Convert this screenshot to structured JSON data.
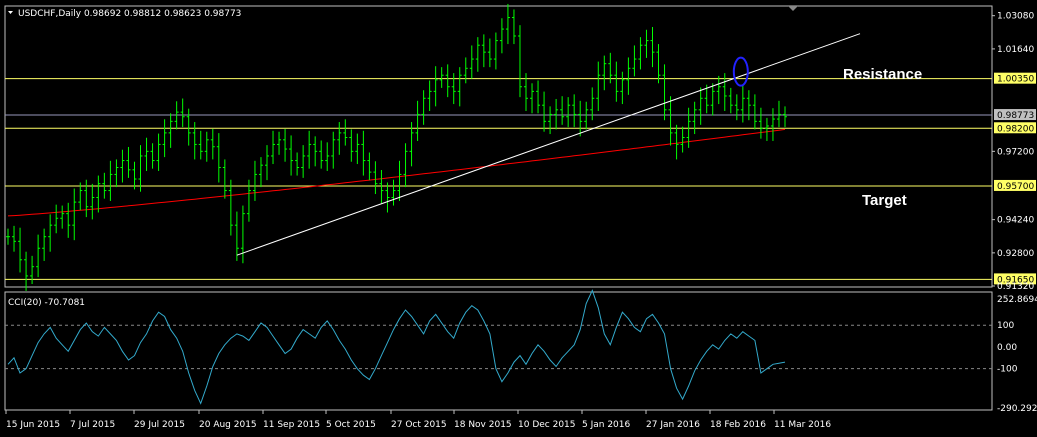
{
  "header": {
    "symbol_line": "USDCHF,Daily  0.98692 0.98812 0.98623 0.98773"
  },
  "annotations": {
    "resistance": "Resistance",
    "target": "Target"
  },
  "colors": {
    "background": "#000000",
    "candles": "#00ff00",
    "moving_average": "#ff0000",
    "trendline": "#ffffff",
    "levels": "#ffff66",
    "current_price": "#9999bb",
    "cci": "#33aacc",
    "ellipse": "#2222ff"
  },
  "chart_data": [
    {
      "type": "candlestick",
      "title": "USDCHF,Daily",
      "ylim": [
        0.9132,
        1.035
      ],
      "x_tick_labels": [
        "15 Jun 2015",
        "7 Jul 2015",
        "29 Jul 2015",
        "20 Aug 2015",
        "11 Sep 2015",
        "5 Oct 2015",
        "27 Oct 2015",
        "18 Nov 2015",
        "10 Dec 2015",
        "5 Jan 2016",
        "27 Jan 2016",
        "18 Feb 2016",
        "11 Mar 2016"
      ],
      "y_tick_labels": [
        "1.03080",
        "1.01640",
        "1.00350",
        "0.98773",
        "0.98200",
        "0.97200",
        "0.95700",
        "0.94240",
        "0.92800",
        "0.91650",
        "0.91320"
      ],
      "horizontal_levels": [
        1.0035,
        0.982,
        0.957,
        0.9165
      ],
      "current_price": 0.98773,
      "close_series": [
        0.935,
        0.933,
        0.925,
        0.918,
        0.922,
        0.93,
        0.935,
        0.94,
        0.943,
        0.945,
        0.94,
        0.95,
        0.955,
        0.948,
        0.952,
        0.958,
        0.955,
        0.962,
        0.965,
        0.968,
        0.964,
        0.96,
        0.97,
        0.972,
        0.968,
        0.975,
        0.98,
        0.985,
        0.989,
        0.987,
        0.98,
        0.975,
        0.972,
        0.977,
        0.974,
        0.965,
        0.955,
        0.94,
        0.93,
        0.945,
        0.955,
        0.962,
        0.966,
        0.97,
        0.975,
        0.977,
        0.973,
        0.968,
        0.965,
        0.97,
        0.975,
        0.972,
        0.968,
        0.97,
        0.977,
        0.98,
        0.978,
        0.972,
        0.975,
        0.968,
        0.963,
        0.958,
        0.955,
        0.952,
        0.955,
        0.962,
        0.972,
        0.98,
        0.988,
        0.995,
        0.998,
        1.003,
        1.005,
        1.0,
        0.998,
        1.005,
        1.008,
        1.012,
        1.018,
        1.015,
        1.012,
        1.02,
        1.025,
        1.03,
        1.022,
        1.0,
        0.995,
        0.998,
        0.992,
        0.985,
        0.988,
        0.99,
        0.987,
        0.992,
        0.988,
        0.985,
        0.99,
        0.995,
        1.005,
        1.01,
        1.005,
        0.998,
        1.003,
        1.008,
        1.012,
        1.018,
        1.02,
        1.015,
        1.005,
        0.99,
        0.98,
        0.975,
        0.978,
        0.985,
        0.99,
        0.995,
        0.992,
        0.998,
        1.0,
        0.996,
        0.992,
        0.99,
        0.995,
        0.992,
        0.985,
        0.982,
        0.983,
        0.986,
        0.988,
        0.987
      ],
      "moving_average_start": 0.944,
      "moving_average_end": 0.9815,
      "trendline": {
        "start_date_index": 38,
        "start_price": 0.927,
        "end_price": 1.023
      },
      "ellipse_center": {
        "date_index": 121,
        "price": 1.0035
      }
    },
    {
      "type": "line",
      "title": "CCI(20) -70.7081",
      "name": "CCI(20)",
      "ylim": [
        -290.2926,
        252.8694
      ],
      "y_tick_labels": [
        "252.8694",
        "100",
        "0.00",
        "-100",
        "-290.2926"
      ],
      "reference_lines": [
        100,
        -100
      ],
      "values": [
        -80,
        -50,
        -120,
        -100,
        -40,
        20,
        60,
        90,
        40,
        10,
        -20,
        30,
        80,
        110,
        70,
        50,
        90,
        60,
        30,
        -20,
        -60,
        -40,
        20,
        60,
        120,
        160,
        140,
        80,
        40,
        -20,
        -120,
        -200,
        -260,
        -180,
        -90,
        -30,
        10,
        40,
        60,
        50,
        30,
        70,
        110,
        90,
        50,
        10,
        -30,
        -10,
        40,
        80,
        60,
        40,
        90,
        120,
        80,
        30,
        -10,
        -60,
        -100,
        -130,
        -150,
        -100,
        -40,
        20,
        80,
        130,
        170,
        140,
        100,
        60,
        120,
        150,
        110,
        70,
        40,
        110,
        160,
        190,
        170,
        120,
        60,
        -100,
        -160,
        -120,
        -70,
        -40,
        -80,
        -30,
        10,
        -20,
        -60,
        -90,
        -50,
        -20,
        10,
        80,
        200,
        260,
        180,
        60,
        10,
        90,
        160,
        130,
        90,
        70,
        130,
        150,
        110,
        60,
        -100,
        -190,
        -240,
        -180,
        -110,
        -60,
        -20,
        10,
        -10,
        30,
        60,
        40,
        70,
        50,
        30,
        -120,
        -100,
        -80,
        -75,
        -70
      ]
    }
  ]
}
